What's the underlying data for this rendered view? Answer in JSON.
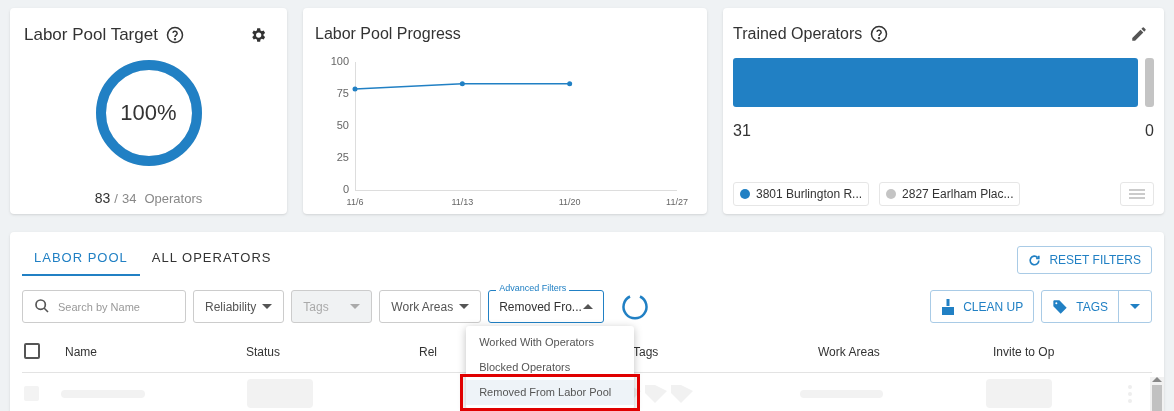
{
  "target_card": {
    "title": "Labor Pool Target",
    "percent": "100%",
    "level": 1,
    "current": "83",
    "separator": "/",
    "total": "34",
    "unit": "Operators"
  },
  "progress_card": {
    "title": "Labor Pool Progress",
    "chart_data": {
      "type": "line",
      "categories": [
        "11/6",
        "11/13",
        "11/20",
        "11/27"
      ],
      "series": [
        {
          "color": "#2180c4",
          "values": [
            79,
            83,
            83,
            null
          ]
        }
      ],
      "ylim": [
        0,
        100
      ],
      "yticks": [
        0,
        25,
        50,
        75,
        100
      ]
    }
  },
  "trained_card": {
    "title": "Trained Operators",
    "segments": [
      {
        "value": "31",
        "color": "#2180c4",
        "grow": true
      },
      {
        "value": "0",
        "color": "#c4c4c4",
        "grow": false
      }
    ],
    "legend": [
      {
        "label": "3801 Burlington R...",
        "color": "#2180c4"
      },
      {
        "label": "2827 Earlham Plac...",
        "color": "#c4c4c4"
      }
    ]
  },
  "tabs": [
    {
      "label": "LABOR POOL",
      "selected": true
    },
    {
      "label": "ALL OPERATORS",
      "selected": false
    }
  ],
  "reset_button": "RESET FILTERS",
  "filters": {
    "search_placeholder": "Search by Name",
    "dropdowns": [
      {
        "label": "Reliability",
        "disabled": false
      },
      {
        "label": "Tags",
        "disabled": true
      },
      {
        "label": "Work Areas",
        "disabled": false
      }
    ],
    "advanced": {
      "label": "Advanced Filters",
      "value": "Removed Fro...",
      "expanded": true,
      "options": [
        {
          "label": "Worked With Operators",
          "selected": false,
          "highlighted": false
        },
        {
          "label": "Blocked Operators",
          "selected": false,
          "highlighted": false
        },
        {
          "label": "Removed From Labor Pool",
          "selected": true,
          "highlighted": true
        }
      ]
    }
  },
  "clean_button": "CLEAN UP",
  "tags_button": "TAGS",
  "table": {
    "select_all_checked": false,
    "columns": [
      "Name",
      "Status",
      "Rel",
      "Tags",
      "Work Areas",
      "Invite to Op"
    ]
  }
}
